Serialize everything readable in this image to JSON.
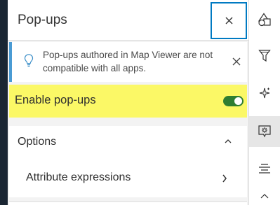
{
  "header": {
    "title": "Pop-ups",
    "close_label": "✕"
  },
  "notice": {
    "text": "Pop-ups authored in Map Viewer are not compatible with all apps."
  },
  "enable": {
    "label": "Enable pop-ups",
    "enabled": true
  },
  "options": {
    "title": "Options",
    "items": [
      {
        "label": "Attribute expressions"
      }
    ]
  },
  "actionbar": {
    "items": [
      {
        "icon": "shapes-icon"
      },
      {
        "icon": "filter-icon"
      },
      {
        "icon": "effects-sparkle-icon"
      },
      {
        "icon": "popup-config-icon",
        "active": true
      },
      {
        "icon": "fields-list-icon"
      },
      {
        "icon": "collapse-up-icon"
      }
    ]
  },
  "colors": {
    "accent": "#007ac2",
    "highlight": "#fbf866",
    "toggle_on": "#2e7d32",
    "notice_bar": "#4a9bd4"
  }
}
